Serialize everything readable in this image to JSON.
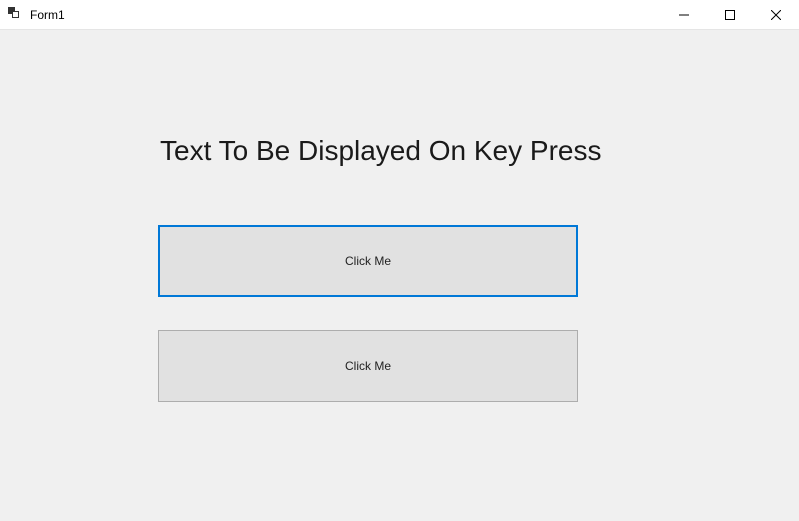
{
  "window": {
    "title": "Form1"
  },
  "content": {
    "heading": "Text To Be Displayed On Key Press",
    "button1_label": "Click Me",
    "button2_label": "Click Me"
  }
}
